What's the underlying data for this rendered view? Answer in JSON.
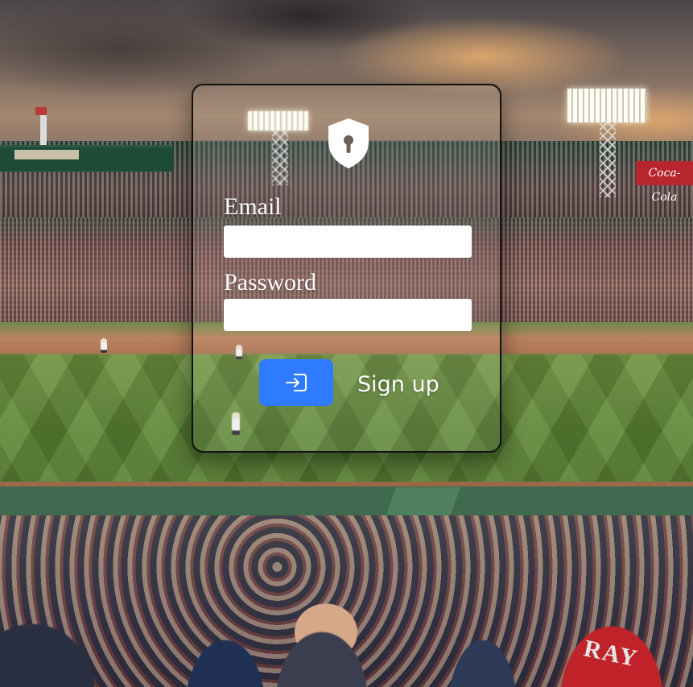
{
  "login_form": {
    "email_label": "Email",
    "email_value": "",
    "password_label": "Password",
    "password_value": "",
    "submit_icon": "sign-in-icon",
    "signup_label": "Sign up",
    "shield_icon": "shield-keyhole-icon"
  },
  "background": {
    "scene": "baseball-stadium-photo",
    "jersey_text": "RAY",
    "sign_text": "Coca-Cola"
  },
  "colors": {
    "submit_button": "#2f7bff",
    "input_background": "#ffffff",
    "label_text": "#ffffff",
    "card_border": "#111111"
  }
}
